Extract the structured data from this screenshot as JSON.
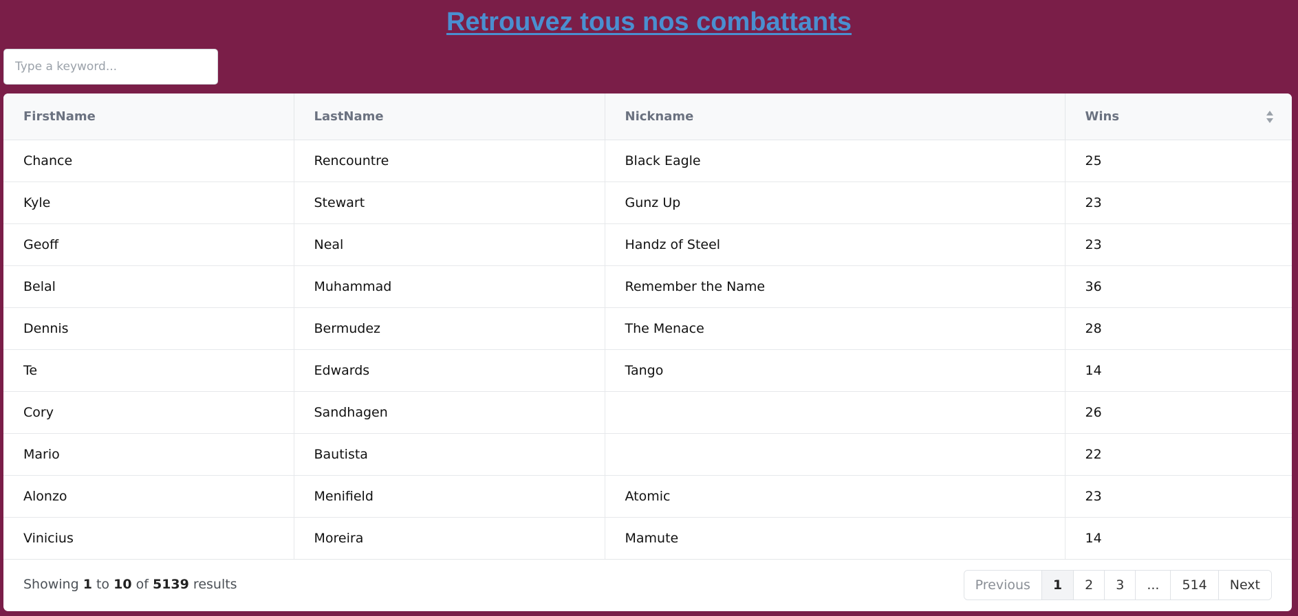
{
  "header": {
    "title": "Retrouvez tous nos combattants"
  },
  "search": {
    "placeholder": "Type a keyword..."
  },
  "table": {
    "columns": [
      "FirstName",
      "LastName",
      "Nickname",
      "Wins"
    ],
    "sort_icon": "sort-icon",
    "rows": [
      [
        "Chance",
        "Rencountre",
        "Black Eagle",
        "25"
      ],
      [
        "Kyle",
        "Stewart",
        "Gunz Up",
        "23"
      ],
      [
        "Geoff",
        "Neal",
        "Handz of Steel",
        "23"
      ],
      [
        "Belal",
        "Muhammad",
        "Remember the Name",
        "36"
      ],
      [
        "Dennis",
        "Bermudez",
        "The Menace",
        "28"
      ],
      [
        "Te",
        "Edwards",
        "Tango",
        "14"
      ],
      [
        "Cory",
        "Sandhagen",
        "",
        "26"
      ],
      [
        "Mario",
        "Bautista",
        "",
        "22"
      ],
      [
        "Alonzo",
        "Menifield",
        "Atomic",
        "23"
      ],
      [
        "Vinicius",
        "Moreira",
        "Mamute",
        "14"
      ]
    ]
  },
  "footer": {
    "showing_label": "Showing",
    "from": "1",
    "to_label": "to",
    "to": "10",
    "of_label": "of",
    "total": "5139",
    "results_label": "results"
  },
  "pagination": {
    "previous": "Previous",
    "pages": [
      "1",
      "2",
      "3",
      "...",
      "514"
    ],
    "active_page": "1",
    "next": "Next"
  },
  "colors": {
    "background": "#7a1e48",
    "title": "#4a8fd0"
  }
}
